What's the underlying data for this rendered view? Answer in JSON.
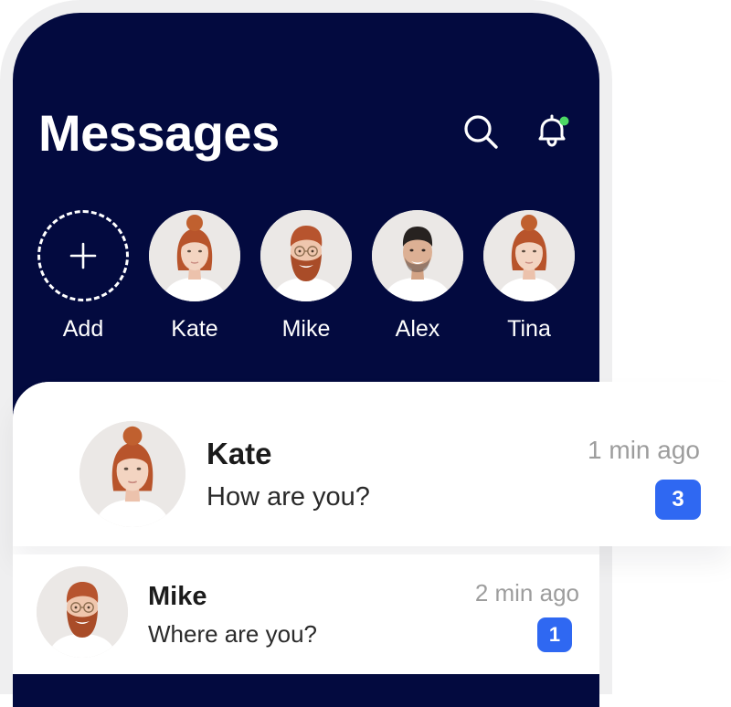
{
  "header": {
    "title": "Messages",
    "search_icon": "search-icon",
    "notification_icon": "bell-icon",
    "notification_dot_color": "#4cd964"
  },
  "stories": {
    "add_label": "Add",
    "items": [
      {
        "name": "Kate"
      },
      {
        "name": "Mike"
      },
      {
        "name": "Alex"
      },
      {
        "name": "Tina"
      }
    ]
  },
  "chats": [
    {
      "name": "Kate",
      "message": "How are you?",
      "time": "1 min ago",
      "unread": "3"
    },
    {
      "name": "Mike",
      "message": "Where are you?",
      "time": "2 min ago",
      "unread": "1"
    }
  ],
  "colors": {
    "background_dark": "#030a3f",
    "accent": "#2f68f2",
    "muted_text": "#9d9d9d"
  }
}
